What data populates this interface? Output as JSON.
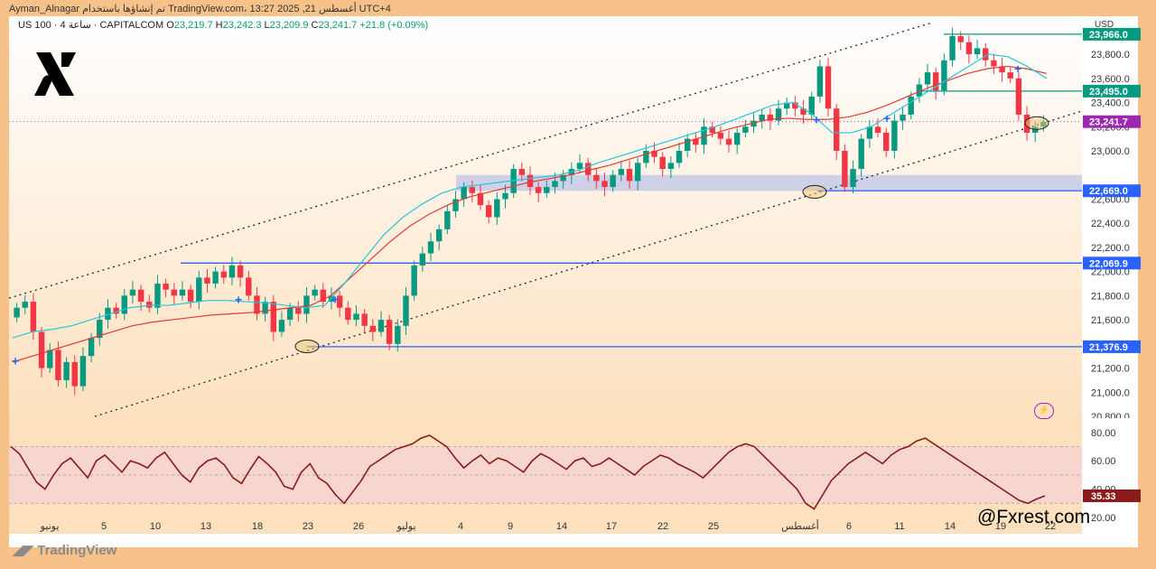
{
  "header": {
    "author_line": "Ayman_Alnagar تم إنشاؤها باستخدام TradingView.com، 13:27 2025 ,21 أغسطس UTC+4"
  },
  "legend": {
    "symbol": "US 100 · 4 ساعة · CAPITALCOM",
    "open_label": "O",
    "open": "23,219.7",
    "high_label": "H",
    "high": "23,242.3",
    "low_label": "L",
    "low": "23,209.9",
    "close_label": "C",
    "close": "23,241.7",
    "change": "+21.8 (+0.09%)"
  },
  "axis": {
    "currency": "USD",
    "flash_icon": "lightning-icon"
  },
  "watermark": "@Fxrest.com",
  "brand": "TradingView",
  "colors": {
    "background": "#ffffff",
    "frame": "#f7c28a",
    "bull": "#089981",
    "bear": "#f23645",
    "ema_fast": "#26c6da",
    "ema_slow": "#e53935",
    "level_line": "#2962ff",
    "rsi_line": "#8b1a1a",
    "zone": "#c5cae9"
  },
  "chart_data": {
    "type": "candlestick",
    "symbol": "US 100",
    "timeframe": "4 ساعة",
    "ylim": [
      20800,
      24100
    ],
    "y_ticks": [
      "20,800.0",
      "21,000.0",
      "21,200.0",
      "21,400.0",
      "21,600.0",
      "21,800.0",
      "22,000.0",
      "22,200.0",
      "22,400.0",
      "22,600.0",
      "23,000.0",
      "23,200.0",
      "23,400.0",
      "23,600.0",
      "23,800.0"
    ],
    "y_tick_values": [
      20800,
      21000,
      21200,
      21400,
      21600,
      21800,
      22000,
      22200,
      22400,
      22600,
      23000,
      23200,
      23400,
      23600,
      23800
    ],
    "x_labels": [
      "يونيو",
      "5",
      "10",
      "13",
      "18",
      "23",
      "26",
      "يوليو",
      "4",
      "9",
      "14",
      "17",
      "22",
      "25",
      "أغسطس",
      "6",
      "11",
      "14",
      "19",
      "22"
    ],
    "price_levels": [
      {
        "value": 23966.0,
        "label": "23,966.0",
        "color": "#089981"
      },
      {
        "value": 23495.0,
        "label": "23,495.0",
        "color": "#089981"
      },
      {
        "value": 23241.7,
        "label": "23,241.7",
        "color": "#9c27b0"
      },
      {
        "value": 22669.0,
        "label": "22,669.0",
        "color": "#2962ff"
      },
      {
        "value": 22069.9,
        "label": "22,069.9",
        "color": "#2962ff"
      },
      {
        "value": 21376.9,
        "label": "21,376.9",
        "color": "#2962ff"
      }
    ],
    "support_zone": [
      22669,
      22800
    ],
    "channel": {
      "upper": [
        [
          0,
          21780
        ],
        [
          86,
          24060
        ]
      ],
      "lower": [
        [
          8,
          20800
        ],
        [
          100,
          23330
        ]
      ]
    },
    "candles_close": [
      21700,
      21750,
      21500,
      21200,
      21350,
      21100,
      21250,
      21050,
      21300,
      21450,
      21600,
      21700,
      21650,
      21800,
      21850,
      21750,
      21700,
      21900,
      21850,
      21800,
      21850,
      21750,
      21950,
      21900,
      22000,
      21950,
      22050,
      21950,
      21800,
      21650,
      21750,
      21500,
      21600,
      21700,
      21650,
      21800,
      21850,
      21750,
      21800,
      21700,
      21600,
      21650,
      21550,
      21500,
      21600,
      21400,
      21550,
      21800,
      22050,
      22150,
      22250,
      22350,
      22500,
      22600,
      22700,
      22650,
      22550,
      22450,
      22600,
      22650,
      22850,
      22800,
      22700,
      22650,
      22700,
      22750,
      22800,
      22850,
      22900,
      22800,
      22750,
      22700,
      22800,
      22850,
      22750,
      22900,
      23000,
      22950,
      22850,
      22900,
      23000,
      23100,
      23050,
      23200,
      23150,
      23100,
      23050,
      23150,
      23200,
      23250,
      23300,
      23250,
      23350,
      23400,
      23350,
      23300,
      23450,
      23700,
      23350,
      23000,
      22700,
      22850,
      23100,
      23200,
      23150,
      23000,
      23250,
      23300,
      23450,
      23550,
      23650,
      23500,
      23750,
      23950,
      23900,
      23800,
      23850,
      23750,
      23700,
      23650,
      23600,
      23300,
      23150,
      23200,
      23241.7
    ],
    "ema_fast": [
      21450,
      21500,
      21520,
      21550,
      21600,
      21650,
      21700,
      21720,
      21720,
      21740,
      21760,
      21760,
      21750,
      21740,
      21720,
      21700,
      21720,
      21900,
      22100,
      22300,
      22450,
      22560,
      22650,
      22700,
      22720,
      22740,
      22760,
      22780,
      22800,
      22840,
      22900,
      22950,
      23000,
      23050,
      23100,
      23150,
      23200,
      23260,
      23320,
      23380,
      23400,
      23300,
      23150,
      23150,
      23200,
      23300,
      23400,
      23500,
      23600,
      23700,
      23800,
      23780,
      23700,
      23600
    ],
    "ema_slow": [
      21250,
      21300,
      21350,
      21400,
      21450,
      21500,
      21550,
      21580,
      21600,
      21620,
      21640,
      21650,
      21660,
      21680,
      21700,
      21720,
      21800,
      21950,
      22100,
      22250,
      22380,
      22480,
      22560,
      22620,
      22660,
      22700,
      22740,
      22770,
      22800,
      22840,
      22880,
      22930,
      22980,
      23030,
      23080,
      23130,
      23180,
      23220,
      23260,
      23270,
      23260,
      23260,
      23280,
      23320,
      23380,
      23450,
      23520,
      23580,
      23640,
      23680,
      23700,
      23680,
      23640
    ],
    "annotations": [
      "blue crosses on fast EMA",
      "circled swing lows at channel support"
    ],
    "rsi": {
      "ylim": [
        20,
        85
      ],
      "y_ticks": [
        "80.00",
        "60.00",
        "40.00",
        "20.00"
      ],
      "y_tick_values": [
        80,
        60,
        40,
        20
      ],
      "upper_band": 70,
      "lower_band": 30,
      "middle": 50,
      "last": "35.33",
      "values": [
        70,
        65,
        55,
        45,
        40,
        50,
        58,
        62,
        55,
        48,
        60,
        64,
        58,
        52,
        60,
        58,
        55,
        62,
        66,
        58,
        50,
        45,
        55,
        60,
        62,
        57,
        48,
        44,
        54,
        63,
        58,
        52,
        42,
        40,
        52,
        58,
        48,
        44,
        36,
        30,
        38,
        46,
        56,
        60,
        64,
        68,
        70,
        72,
        76,
        78,
        74,
        70,
        62,
        55,
        60,
        64,
        58,
        62,
        60,
        56,
        52,
        60,
        65,
        62,
        58,
        54,
        60,
        62,
        56,
        58,
        62,
        58,
        54,
        50,
        56,
        60,
        64,
        62,
        58,
        55,
        52,
        48,
        54,
        60,
        66,
        70,
        72,
        70,
        64,
        58,
        52,
        46,
        40,
        30,
        26,
        36,
        46,
        52,
        58,
        62,
        66,
        62,
        58,
        64,
        68,
        70,
        74,
        76,
        72,
        68,
        64,
        60,
        56,
        52,
        48,
        44,
        40,
        36,
        32,
        30,
        33,
        35.33
      ]
    }
  }
}
